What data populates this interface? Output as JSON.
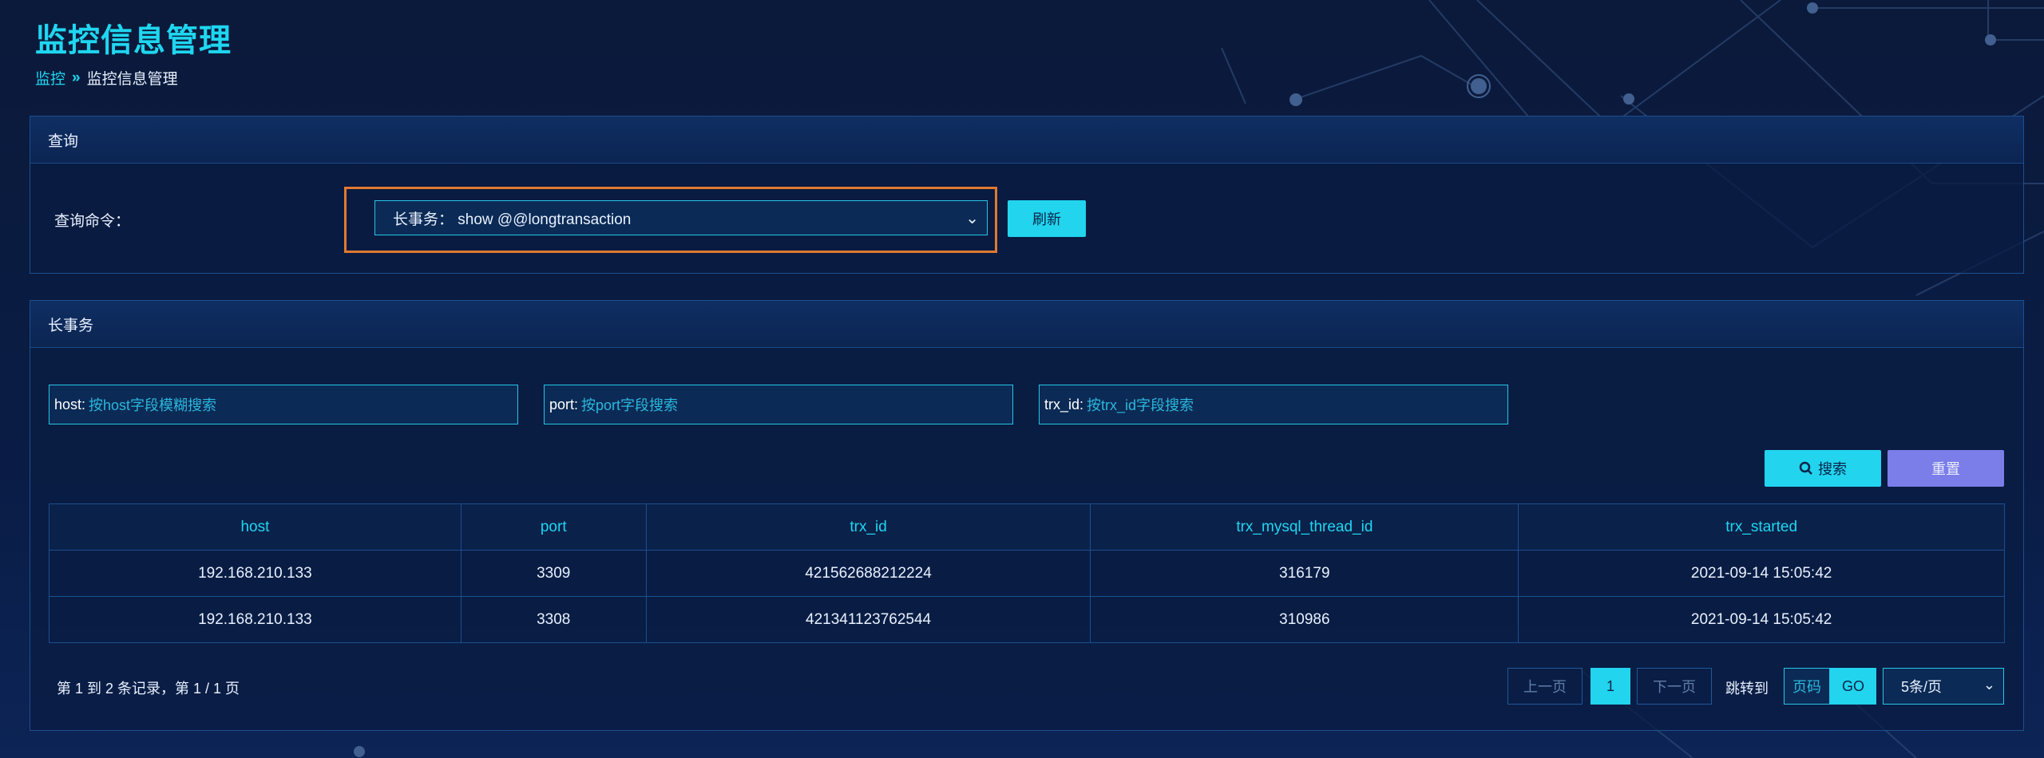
{
  "page": {
    "title": "监控信息管理"
  },
  "breadcrumb": {
    "parent": "监控",
    "separator": "»",
    "current": "监控信息管理"
  },
  "query_panel": {
    "title": "查询",
    "label": "查询命令：",
    "command_selected": "长事务：  show @@longtransaction",
    "refresh_label": "刷新"
  },
  "result_panel": {
    "title": "长事务",
    "filters": [
      {
        "label": "host:",
        "placeholder": "按host字段模糊搜索"
      },
      {
        "label": "port:",
        "placeholder": "按port字段搜索"
      },
      {
        "label": "trx_id:",
        "placeholder": "按trx_id字段搜索"
      }
    ],
    "search_label": "搜索",
    "reset_label": "重置",
    "columns": [
      "host",
      "port",
      "trx_id",
      "trx_mysql_thread_id",
      "trx_started"
    ],
    "rows": [
      [
        "192.168.210.133",
        "3309",
        "421562688212224",
        "316179",
        "2021-09-14 15:05:42"
      ],
      [
        "192.168.210.133",
        "3308",
        "421341123762544",
        "310986",
        "2021-09-14 15:05:42"
      ]
    ]
  },
  "pagination": {
    "info": "第 1 到 2 条记录，第 1 / 1 页",
    "prev_label": "上一页",
    "current_page": "1",
    "next_label": "下一页",
    "jump_label": "跳转到",
    "page_input_placeholder": "页码",
    "go_label": "GO",
    "page_size": "5条/页"
  },
  "colors": {
    "accent": "#22d4ee",
    "highlight": "#e07a30",
    "reset": "#7b7de8"
  }
}
